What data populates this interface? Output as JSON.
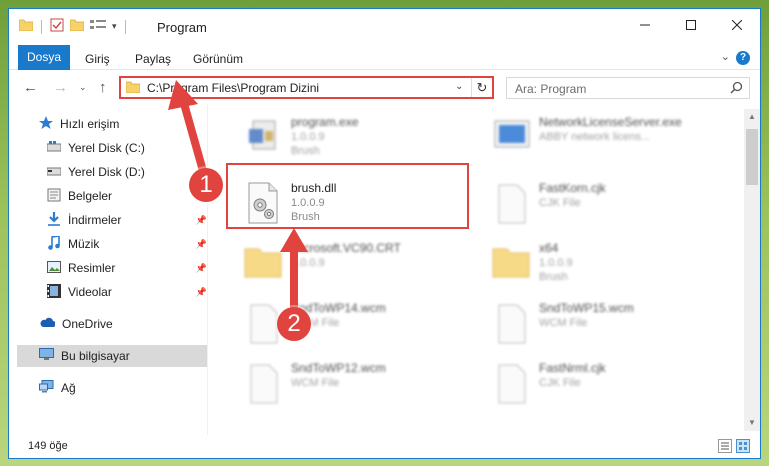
{
  "window": {
    "title": "Program",
    "controls": [
      "minimize",
      "maximize",
      "close"
    ]
  },
  "ribbon": {
    "tabs": [
      "Dosya",
      "Giriş",
      "Paylaş",
      "Görünüm"
    ],
    "help": "?"
  },
  "nav": {
    "address_path": "C:\\Program Files\\Program Dizini",
    "search_placeholder": "Ara: Program"
  },
  "sidebar": {
    "items": [
      {
        "label": "Hızlı erişim",
        "icon": "star-icon",
        "pinned": false
      },
      {
        "label": "Yerel Disk (C:)",
        "icon": "drive-icon",
        "pinned": false
      },
      {
        "label": "Yerel Disk (D:)",
        "icon": "drive-icon",
        "pinned": false
      },
      {
        "label": "Belgeler",
        "icon": "documents-icon",
        "pinned": true
      },
      {
        "label": "İndirmeler",
        "icon": "download-icon",
        "pinned": true
      },
      {
        "label": "Müzik",
        "icon": "music-icon",
        "pinned": true
      },
      {
        "label": "Resimler",
        "icon": "pictures-icon",
        "pinned": true
      },
      {
        "label": "Videolar",
        "icon": "video-icon",
        "pinned": true
      },
      {
        "label": "OneDrive",
        "icon": "cloud-icon",
        "pinned": false
      },
      {
        "label": "Bu bilgisayar",
        "icon": "computer-icon",
        "pinned": false,
        "selected": true
      },
      {
        "label": "Ağ",
        "icon": "network-icon",
        "pinned": false
      }
    ]
  },
  "files": [
    {
      "name": "program.exe",
      "line2": "1.0.0.9",
      "line3": "Brush",
      "icon": "exe-icon",
      "blurred": true
    },
    {
      "name": "NetworkLicenseServer.exe",
      "line2": "ABBY network licens...",
      "line3": "",
      "icon": "exe-icon",
      "blurred": true
    },
    {
      "name": "brush.dll",
      "line2": "1.0.0.9",
      "line3": "Brush",
      "icon": "dll-gear-icon",
      "blurred": false
    },
    {
      "name": "FastKorn.cjk",
      "line2": "CJK File",
      "line3": "",
      "icon": "file-icon",
      "blurred": true
    },
    {
      "name": "Microsoft.VC90.CRT",
      "line2": "1.0.0.9",
      "line3": "",
      "icon": "folder-icon",
      "blurred": true
    },
    {
      "name": "x64",
      "line2": "1.0.0.9",
      "line3": "Brush",
      "icon": "folder-icon",
      "blurred": true
    },
    {
      "name": "SndToWP14.wcm",
      "line2": "WCM File",
      "line3": "",
      "icon": "file-icon",
      "blurred": true
    },
    {
      "name": "SndToWP15.wcm",
      "line2": "WCM File",
      "line3": "",
      "icon": "file-icon",
      "blurred": true
    },
    {
      "name": "SndToWP12.wcm",
      "line2": "WCM File",
      "line3": "",
      "icon": "file-icon",
      "blurred": true
    },
    {
      "name": "FastNrml.cjk",
      "line2": "CJK File",
      "line3": "",
      "icon": "file-icon",
      "blurred": true
    }
  ],
  "status": {
    "item_count": "149 öğe"
  },
  "annotations": [
    "1",
    "2"
  ],
  "colors": {
    "accent": "#1979ca",
    "annotation": "#e1433f",
    "folder": "#f6d26b"
  }
}
